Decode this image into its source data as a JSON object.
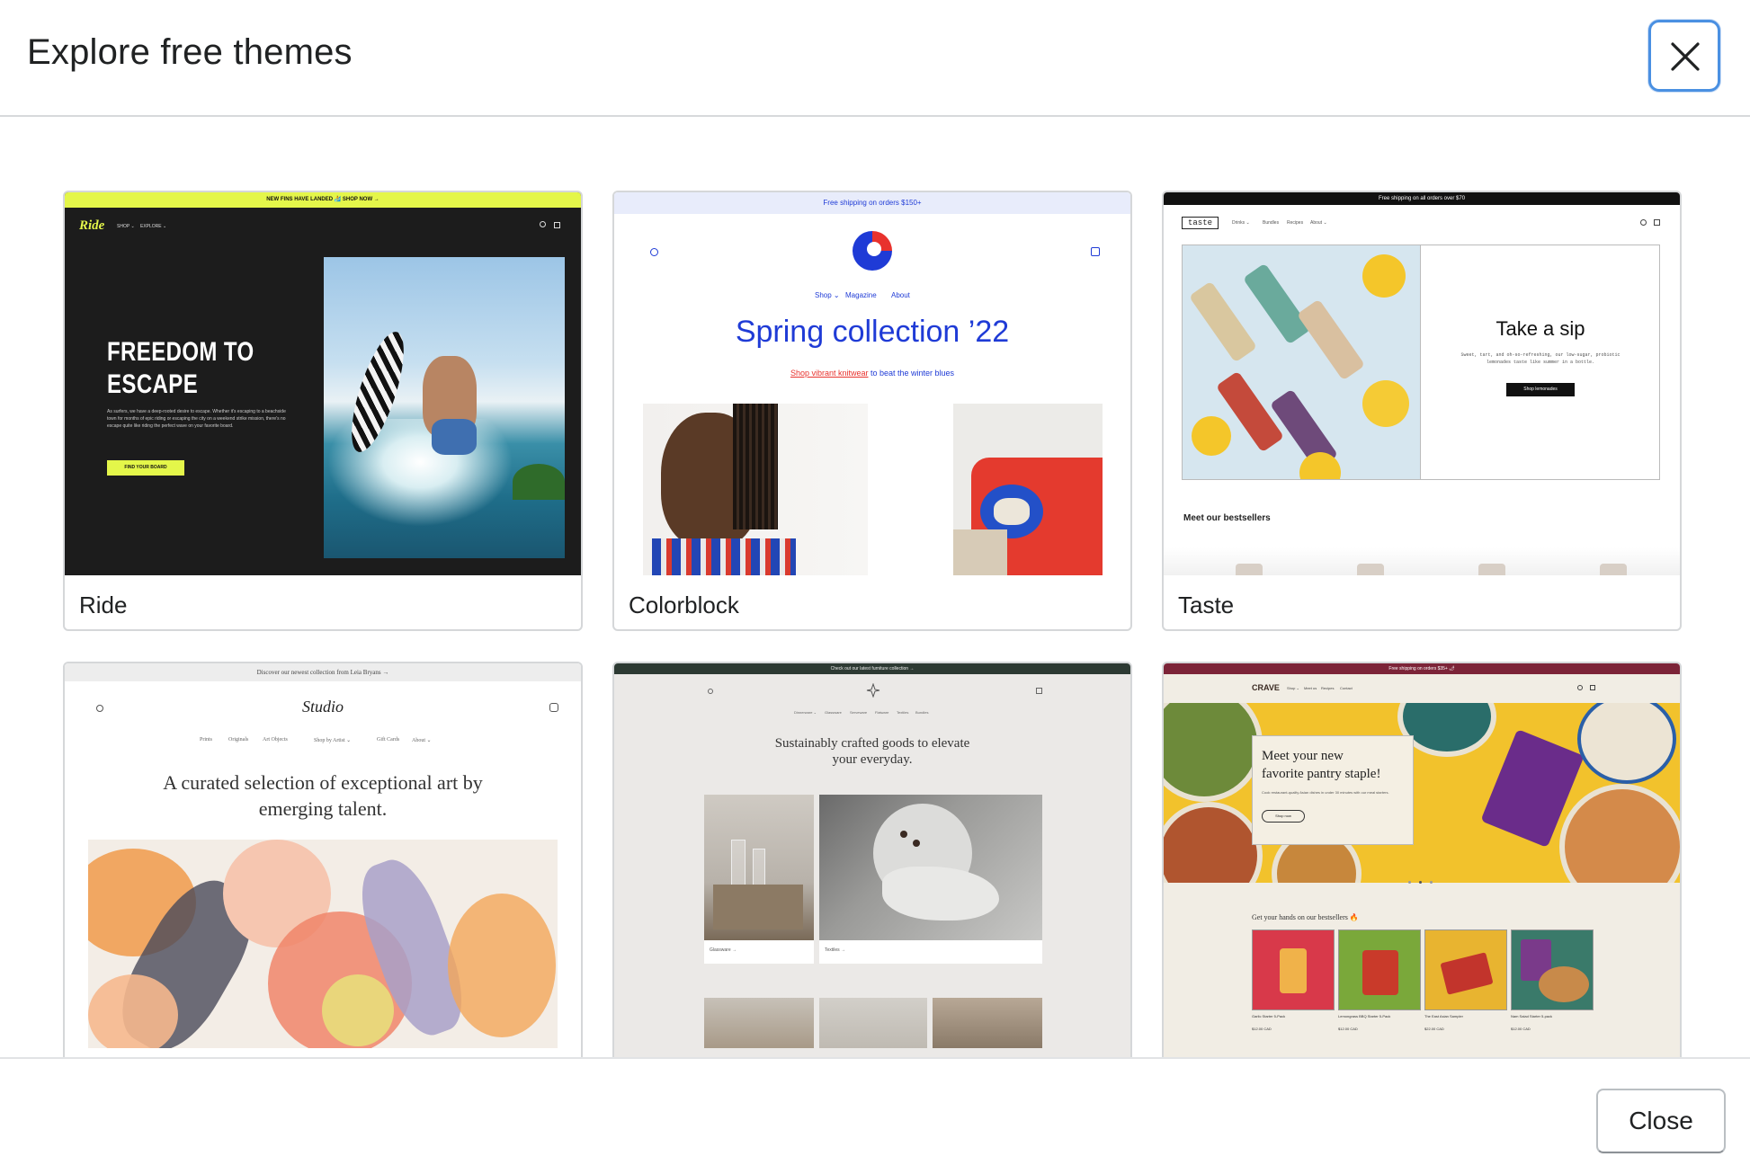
{
  "modal": {
    "title": "Explore free themes",
    "close_icon": "close-icon",
    "footer_close_label": "Close"
  },
  "themes": [
    {
      "name": "Ride",
      "preview": {
        "announcement": "NEW FINS HAVE LANDED 🏄 SHOP NOW →",
        "logo": "Ride",
        "nav": [
          "SHOP ⌄",
          "EXPLORE ⌄"
        ],
        "headline_1": "FREEDOM TO",
        "headline_2": "ESCAPE",
        "body": "As surfers, we have a deep-rooted desire to escape. Whether it's escaping to a beachside town for months of epic riding or escaping the city on a weekend strike mission, there's no escape quite like riding the perfect wave on your favorite board.",
        "cta": "FIND YOUR BOARD",
        "accent": "#e4f64a"
      }
    },
    {
      "name": "Colorblock",
      "preview": {
        "announcement": "Free shipping on orders $150+",
        "nav": [
          "Shop ⌄",
          "Magazine",
          "About"
        ],
        "headline": "Spring collection ’22",
        "sub_link": "Shop vibrant knitwear",
        "sub_rest": " to beat the winter blues",
        "accent": "#1f3bd6"
      }
    },
    {
      "name": "Taste",
      "preview": {
        "announcement": "Free shipping on all orders over $70",
        "logo": "taste",
        "nav": [
          "Drinks ⌄",
          "Bundles",
          "Recipes",
          "About ⌄"
        ],
        "headline": "Take a sip",
        "body": "Sweet, tart, and oh-so-refreshing, our low-sugar, probiotic lemonades taste like summer in a bottle.",
        "cta": "Shop lemonades",
        "section": "Meet our bestsellers"
      }
    },
    {
      "name": "",
      "preview": {
        "announcement": "Discover our newest collection from Leia Bryans →",
        "logo": "Studio",
        "nav": [
          "Prints",
          "Originals",
          "Art Objects",
          "Shop by Artist ⌄",
          "Gift Cards",
          "About ⌄"
        ],
        "headline_1": "A curated selection of exceptional art by",
        "headline_2": "emerging talent."
      }
    },
    {
      "name": "",
      "preview": {
        "announcement": "Check out our latest furniture collection →",
        "nav": [
          "Dinnerware ⌄",
          "Glassware",
          "Serveware",
          "Flatware",
          "Textiles",
          "Bundles"
        ],
        "headline_1": "Sustainably crafted goods to elevate",
        "headline_2": "your everyday.",
        "tile_1": "Glassware →",
        "tile_2": "Textiles →"
      }
    },
    {
      "name": "",
      "preview": {
        "announcement": "Free shipping on orders $35+ 🌶",
        "logo": "CRAVE",
        "nav": [
          "Shop ⌄",
          "Meet us",
          "Recipes",
          "Contact"
        ],
        "headline_1": "Meet your new",
        "headline_2": "favorite pantry staple!",
        "body": "Cook restaurant-quality Asian dishes in under 30 minutes with our meal starters.",
        "cta": "Shop now",
        "section": "Get your hands on our bestsellers 🔥",
        "products": [
          {
            "name": "Garlic Starter 5-Pack",
            "price": "$12.00 CAD"
          },
          {
            "name": "Lemongrass BBQ Starter 5-Pack",
            "price": "$12.00 CAD"
          },
          {
            "name": "The East Asian Sampler",
            "price": "$22.00 CAD"
          },
          {
            "name": "Nam Salad Starter 5-pack",
            "price": "$12.00 CAD"
          }
        ]
      }
    }
  ]
}
